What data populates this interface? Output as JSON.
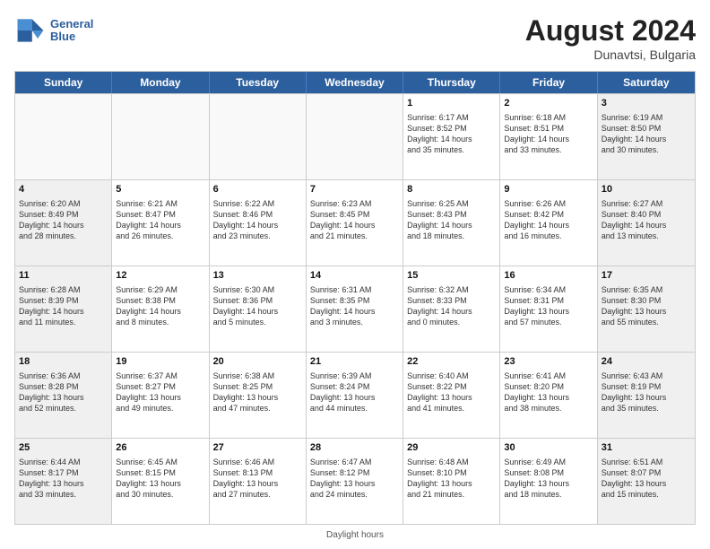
{
  "header": {
    "logo_line1": "General",
    "logo_line2": "Blue",
    "month_year": "August 2024",
    "location": "Dunavtsi, Bulgaria"
  },
  "days_of_week": [
    "Sunday",
    "Monday",
    "Tuesday",
    "Wednesday",
    "Thursday",
    "Friday",
    "Saturday"
  ],
  "footer": "Daylight hours",
  "weeks": [
    [
      {
        "day": "",
        "info": "",
        "empty": true
      },
      {
        "day": "",
        "info": "",
        "empty": true
      },
      {
        "day": "",
        "info": "",
        "empty": true
      },
      {
        "day": "",
        "info": "",
        "empty": true
      },
      {
        "day": "1",
        "info": "Sunrise: 6:17 AM\nSunset: 8:52 PM\nDaylight: 14 hours\nand 35 minutes."
      },
      {
        "day": "2",
        "info": "Sunrise: 6:18 AM\nSunset: 8:51 PM\nDaylight: 14 hours\nand 33 minutes."
      },
      {
        "day": "3",
        "info": "Sunrise: 6:19 AM\nSunset: 8:50 PM\nDaylight: 14 hours\nand 30 minutes."
      }
    ],
    [
      {
        "day": "4",
        "info": "Sunrise: 6:20 AM\nSunset: 8:49 PM\nDaylight: 14 hours\nand 28 minutes."
      },
      {
        "day": "5",
        "info": "Sunrise: 6:21 AM\nSunset: 8:47 PM\nDaylight: 14 hours\nand 26 minutes."
      },
      {
        "day": "6",
        "info": "Sunrise: 6:22 AM\nSunset: 8:46 PM\nDaylight: 14 hours\nand 23 minutes."
      },
      {
        "day": "7",
        "info": "Sunrise: 6:23 AM\nSunset: 8:45 PM\nDaylight: 14 hours\nand 21 minutes."
      },
      {
        "day": "8",
        "info": "Sunrise: 6:25 AM\nSunset: 8:43 PM\nDaylight: 14 hours\nand 18 minutes."
      },
      {
        "day": "9",
        "info": "Sunrise: 6:26 AM\nSunset: 8:42 PM\nDaylight: 14 hours\nand 16 minutes."
      },
      {
        "day": "10",
        "info": "Sunrise: 6:27 AM\nSunset: 8:40 PM\nDaylight: 14 hours\nand 13 minutes."
      }
    ],
    [
      {
        "day": "11",
        "info": "Sunrise: 6:28 AM\nSunset: 8:39 PM\nDaylight: 14 hours\nand 11 minutes."
      },
      {
        "day": "12",
        "info": "Sunrise: 6:29 AM\nSunset: 8:38 PM\nDaylight: 14 hours\nand 8 minutes."
      },
      {
        "day": "13",
        "info": "Sunrise: 6:30 AM\nSunset: 8:36 PM\nDaylight: 14 hours\nand 5 minutes."
      },
      {
        "day": "14",
        "info": "Sunrise: 6:31 AM\nSunset: 8:35 PM\nDaylight: 14 hours\nand 3 minutes."
      },
      {
        "day": "15",
        "info": "Sunrise: 6:32 AM\nSunset: 8:33 PM\nDaylight: 14 hours\nand 0 minutes."
      },
      {
        "day": "16",
        "info": "Sunrise: 6:34 AM\nSunset: 8:31 PM\nDaylight: 13 hours\nand 57 minutes."
      },
      {
        "day": "17",
        "info": "Sunrise: 6:35 AM\nSunset: 8:30 PM\nDaylight: 13 hours\nand 55 minutes."
      }
    ],
    [
      {
        "day": "18",
        "info": "Sunrise: 6:36 AM\nSunset: 8:28 PM\nDaylight: 13 hours\nand 52 minutes."
      },
      {
        "day": "19",
        "info": "Sunrise: 6:37 AM\nSunset: 8:27 PM\nDaylight: 13 hours\nand 49 minutes."
      },
      {
        "day": "20",
        "info": "Sunrise: 6:38 AM\nSunset: 8:25 PM\nDaylight: 13 hours\nand 47 minutes."
      },
      {
        "day": "21",
        "info": "Sunrise: 6:39 AM\nSunset: 8:24 PM\nDaylight: 13 hours\nand 44 minutes."
      },
      {
        "day": "22",
        "info": "Sunrise: 6:40 AM\nSunset: 8:22 PM\nDaylight: 13 hours\nand 41 minutes."
      },
      {
        "day": "23",
        "info": "Sunrise: 6:41 AM\nSunset: 8:20 PM\nDaylight: 13 hours\nand 38 minutes."
      },
      {
        "day": "24",
        "info": "Sunrise: 6:43 AM\nSunset: 8:19 PM\nDaylight: 13 hours\nand 35 minutes."
      }
    ],
    [
      {
        "day": "25",
        "info": "Sunrise: 6:44 AM\nSunset: 8:17 PM\nDaylight: 13 hours\nand 33 minutes."
      },
      {
        "day": "26",
        "info": "Sunrise: 6:45 AM\nSunset: 8:15 PM\nDaylight: 13 hours\nand 30 minutes."
      },
      {
        "day": "27",
        "info": "Sunrise: 6:46 AM\nSunset: 8:13 PM\nDaylight: 13 hours\nand 27 minutes."
      },
      {
        "day": "28",
        "info": "Sunrise: 6:47 AM\nSunset: 8:12 PM\nDaylight: 13 hours\nand 24 minutes."
      },
      {
        "day": "29",
        "info": "Sunrise: 6:48 AM\nSunset: 8:10 PM\nDaylight: 13 hours\nand 21 minutes."
      },
      {
        "day": "30",
        "info": "Sunrise: 6:49 AM\nSunset: 8:08 PM\nDaylight: 13 hours\nand 18 minutes."
      },
      {
        "day": "31",
        "info": "Sunrise: 6:51 AM\nSunset: 8:07 PM\nDaylight: 13 hours\nand 15 minutes."
      }
    ]
  ]
}
